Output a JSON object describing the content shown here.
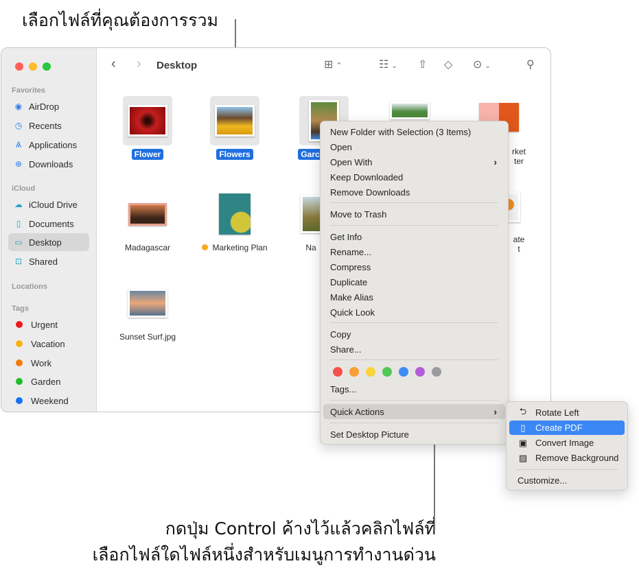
{
  "callouts": {
    "top": "เลือกไฟล์ที่คุณต้องการรวม",
    "bottom_line1": "กดปุ่ม Control ค้างไว้แล้วคลิกไฟล์ที่",
    "bottom_line2": "เลือกไฟล์ใดไฟล์หนึ่งสำหรับเมนูการทำงานด่วน"
  },
  "window": {
    "title": "Desktop",
    "traffic_colors": {
      "close": "#fe5f57",
      "minimize": "#febc2e",
      "zoom": "#28c840"
    }
  },
  "toolbar": {
    "back_icon": "chevron-left-icon",
    "forward_icon": "chevron-right-icon",
    "icons": [
      "grid-view-icon",
      "group-icon",
      "share-icon",
      "tag-icon",
      "more-icon",
      "search-icon"
    ]
  },
  "sidebar": {
    "favorites_label": "Favorites",
    "favorites": [
      {
        "label": "AirDrop",
        "icon": "airdrop-icon"
      },
      {
        "label": "Recents",
        "icon": "clock-icon"
      },
      {
        "label": "Applications",
        "icon": "applications-icon"
      },
      {
        "label": "Downloads",
        "icon": "download-icon"
      }
    ],
    "icloud_label": "iCloud",
    "icloud": [
      {
        "label": "iCloud Drive",
        "icon": "cloud-icon"
      },
      {
        "label": "Documents",
        "icon": "document-icon"
      },
      {
        "label": "Desktop",
        "icon": "desktop-icon",
        "active": true
      },
      {
        "label": "Shared",
        "icon": "shared-folder-icon"
      }
    ],
    "locations_label": "Locations",
    "tags_label": "Tags",
    "tags": [
      {
        "label": "Urgent",
        "color": "#f0161c"
      },
      {
        "label": "Vacation",
        "color": "#f5b40f"
      },
      {
        "label": "Work",
        "color": "#f47b0f"
      },
      {
        "label": "Garden",
        "color": "#1fbd28"
      },
      {
        "label": "Weekend",
        "color": "#1672f5"
      }
    ]
  },
  "files": [
    {
      "name": "Flower",
      "selected": true
    },
    {
      "name": "Flowers",
      "selected": true
    },
    {
      "name": "Garden",
      "selected": true,
      "visible_name": "Garc"
    },
    {
      "name": "Madagascar",
      "selected": false
    },
    {
      "name": "Marketing Plan",
      "selected": false,
      "tag_color": "#f9a825"
    },
    {
      "name": "Na",
      "selected": false
    },
    {
      "name": "rket",
      "selected": false,
      "line2": "ter"
    },
    {
      "name": "ate",
      "selected": false,
      "line2": "t"
    },
    {
      "name": "Sunset Surf.jpg",
      "selected": false
    }
  ],
  "context_menu": {
    "items": [
      "New Folder with Selection (3 Items)",
      "Open",
      "Open With",
      "Keep Downloaded",
      "Remove Downloads",
      "Move to Trash",
      "Get Info",
      "Rename...",
      "Compress",
      "Duplicate",
      "Make Alias",
      "Quick Look",
      "Copy",
      "Share...",
      "Tags...",
      "Quick Actions",
      "Set Desktop Picture"
    ],
    "tag_colors": [
      "#f7504a",
      "#f99d35",
      "#fbd33a",
      "#51c756",
      "#3b8df5",
      "#b35ed9",
      "#9b9b9d"
    ]
  },
  "quick_actions_menu": {
    "items": [
      {
        "label": "Rotate Left",
        "icon": "rotate-left-icon"
      },
      {
        "label": "Create PDF",
        "icon": "pdf-document-icon",
        "highlighted": true
      },
      {
        "label": "Convert Image",
        "icon": "convert-image-icon"
      },
      {
        "label": "Remove Background",
        "icon": "remove-background-icon"
      }
    ],
    "customize": "Customize..."
  }
}
